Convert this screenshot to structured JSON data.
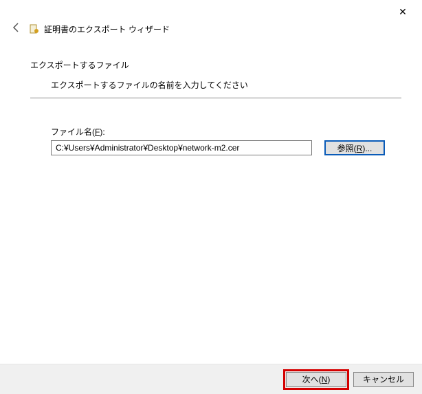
{
  "window": {
    "title": "証明書のエクスポート ウィザード",
    "close_label": "✕"
  },
  "page": {
    "heading": "エクスポートするファイル",
    "description": "エクスポートするファイルの名前を入力してください"
  },
  "file_field": {
    "label_prefix": "ファイル名(",
    "label_key": "F",
    "label_suffix": "):",
    "value": "C:¥Users¥Administrator¥Desktop¥network-m2.cer",
    "browse_prefix": "参照(",
    "browse_key": "R",
    "browse_suffix": ")..."
  },
  "footer": {
    "next_prefix": "次へ(",
    "next_key": "N",
    "next_suffix": ")",
    "cancel": "キャンセル"
  }
}
